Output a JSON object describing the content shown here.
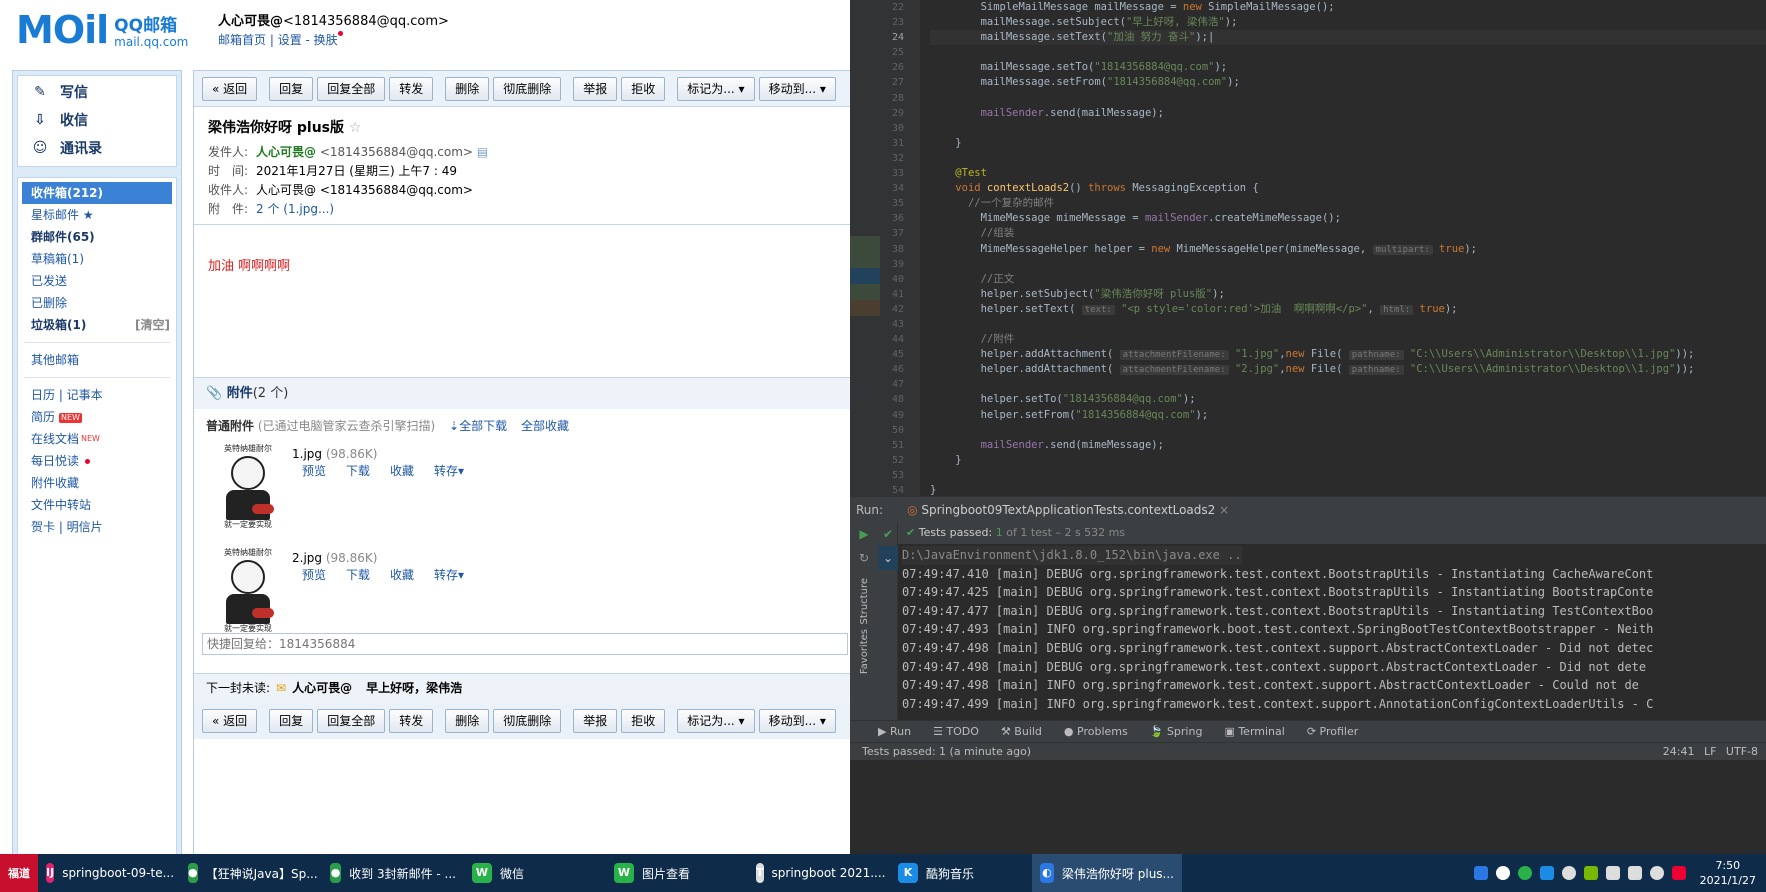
{
  "mail": {
    "logo": {
      "big": "MOil",
      "name": "QQ邮箱",
      "domain": "mail.qq.com"
    },
    "user": {
      "name": "人心可畏@",
      "email": "<1814356884@qq.com>",
      "home": "邮箱首页",
      "settings": "设置",
      "skin": "换肤"
    },
    "compose": "写信",
    "receive": "收信",
    "contacts": "通讯录",
    "folders": [
      {
        "label": "收件箱(212)",
        "selected": true
      },
      {
        "label": "星标邮件 ★"
      },
      {
        "label": "群邮件(65)",
        "bold": true
      },
      {
        "label": "草稿箱(1)"
      },
      {
        "label": "已发送"
      },
      {
        "label": "已删除"
      },
      {
        "label": "垃圾箱(1)",
        "bold": true,
        "right": "[清空]"
      },
      {
        "label": "其他邮箱"
      },
      {
        "label": "日历 | 记事本"
      },
      {
        "label": "简历",
        "badge": "NEW"
      },
      {
        "label": "在线文档",
        "sup": "NEW"
      },
      {
        "label": "每日悦读",
        "dot": true
      },
      {
        "label": "附件收藏"
      },
      {
        "label": "文件中转站"
      },
      {
        "label": "贺卡 | 明信片"
      }
    ],
    "toolbar": [
      "« 返回",
      "回复",
      "回复全部",
      "转发",
      "删除",
      "彻底删除",
      "举报",
      "拒收",
      "标记为... ▾",
      "移动到... ▾"
    ],
    "subject": "梁伟浩你好呀 plus版",
    "sender_label": "发件人:",
    "sender_name": "人心可畏@",
    "sender_email": "<1814356884@qq.com>",
    "time_label": "时　间:",
    "time": "2021年1月27日 (星期三) 上午7 : 49",
    "to_label": "收件人:",
    "to": "人心可畏@ <1814356884@qq.com>",
    "att_label": "附　件:",
    "att_summary": "2 个 (1.jpg...)",
    "body": "加油 啊啊啊啊",
    "attachments_title": "附件",
    "attachments_count": "(2 个)",
    "att_common": "普通附件",
    "att_scan": "(已通过电脑管家云查杀引擎扫描)",
    "download_all": "全部下载",
    "collect_all": "全部收藏",
    "att_files": [
      {
        "name": "1.jpg",
        "size": "(98.86K)",
        "caption": "英特纳雄耐尔",
        "caption2": "就一定要实现"
      },
      {
        "name": "2.jpg",
        "size": "(98.86K)",
        "caption": "英特纳雄耐尔",
        "caption2": "就一定要实现"
      }
    ],
    "att_actions": [
      "预览",
      "下载",
      "收藏",
      "转存▾"
    ],
    "quick_reply": "快捷回复给：1814356884",
    "next_label": "下一封未读:",
    "next_from": "人心可畏@",
    "next_subject": "早上好呀，梁伟浩"
  },
  "ide": {
    "code_lines": [
      {
        "n": "22",
        "html": "        SimpleMailMessage mailMessage = <span class='kw'>new</span> SimpleMailMessage();"
      },
      {
        "n": "23",
        "html": "        mailMessage.setSubject(<span class='str'>\"早上好呀, 梁伟浩\"</span>);"
      },
      {
        "n": "24",
        "html": "        mailMessage.setText(<span class='str'>\"加油 努力 奋斗\"</span>);|",
        "cur": true
      },
      {
        "n": "25",
        "html": ""
      },
      {
        "n": "26",
        "html": "        mailMessage.setTo(<span class='str'>\"1814356884@qq.com\"</span>);"
      },
      {
        "n": "27",
        "html": "        mailMessage.setFrom(<span class='str'>\"1814356884@qq.com\"</span>);"
      },
      {
        "n": "28",
        "html": ""
      },
      {
        "n": "29",
        "html": "        <span class='fld'>mailSender</span>.send(mailMessage);"
      },
      {
        "n": "30",
        "html": ""
      },
      {
        "n": "31",
        "html": "    }"
      },
      {
        "n": "32",
        "html": ""
      },
      {
        "n": "33",
        "html": "    <span class='an'>@Test</span>"
      },
      {
        "n": "34",
        "html": "    <span class='kw'>void</span> <span class='fn'>contextLoads2</span>() <span class='kw'>throws</span> MessagingException {"
      },
      {
        "n": "35",
        "html": "      <span class='cm'>//一个复杂的邮件</span>"
      },
      {
        "n": "36",
        "html": "        MimeMessage mimeMessage = <span class='fld'>mailSender</span>.createMimeMessage();"
      },
      {
        "n": "37",
        "html": "        <span class='cm'>//组装</span>"
      },
      {
        "n": "38",
        "html": "        MimeMessageHelper helper = <span class='kw'>new</span> MimeMessageHelper(mimeMessage, <span class='hint'>multipart:</span> <span class='kw'>true</span>);"
      },
      {
        "n": "39",
        "html": ""
      },
      {
        "n": "40",
        "html": "        <span class='cm'>//正文</span>"
      },
      {
        "n": "41",
        "html": "        helper.setSubject(<span class='str'>\"梁伟浩你好呀 plus版\"</span>);"
      },
      {
        "n": "42",
        "html": "        helper.setText( <span class='hint'>text:</span> <span class='str'>\"&lt;p style='color:red'&gt;加油  啊啊啊啊&lt;/p&gt;\"</span>, <span class='hint'>html:</span> <span class='kw'>true</span>);"
      },
      {
        "n": "43",
        "html": ""
      },
      {
        "n": "44",
        "html": "        <span class='cm'>//附件</span>"
      },
      {
        "n": "45",
        "html": "        helper.addAttachment( <span class='hint'>attachmentFilename:</span> <span class='str'>\"1.jpg\"</span>,<span class='kw'>new</span> File( <span class='hint'>pathname:</span> <span class='str'>\"C:\\\\Users\\\\Administrator\\\\Desktop\\\\1.jpg\"</span>));"
      },
      {
        "n": "46",
        "html": "        helper.addAttachment( <span class='hint'>attachmentFilename:</span> <span class='str'>\"2.jpg\"</span>,<span class='kw'>new</span> File( <span class='hint'>pathname:</span> <span class='str'>\"C:\\\\Users\\\\Administrator\\\\Desktop\\\\1.jpg\"</span>));"
      },
      {
        "n": "47",
        "html": ""
      },
      {
        "n": "48",
        "html": "        helper.setTo(<span class='str'>\"1814356884@qq.com\"</span>);"
      },
      {
        "n": "49",
        "html": "        helper.setFrom(<span class='str'>\"1814356884@qq.com\"</span>);"
      },
      {
        "n": "50",
        "html": ""
      },
      {
        "n": "51",
        "html": "        <span class='fld'>mailSender</span>.send(mimeMessage);"
      },
      {
        "n": "52",
        "html": "    }"
      },
      {
        "n": "53",
        "html": ""
      },
      {
        "n": "54",
        "html": "}"
      }
    ],
    "run_label": "Run:",
    "run_tab": "Springboot09TextApplicationTests.contextLoads2",
    "tests_passed": "Tests passed:",
    "tests_count": "1",
    "tests_detail": "of 1 test – 2 s 532 ms",
    "console": [
      "D:\\JavaEnvironment\\jdk1.8.0_152\\bin\\java.exe ...",
      "07:49:47.410 [main] DEBUG org.springframework.test.context.BootstrapUtils - Instantiating CacheAwareCont",
      "07:49:47.425 [main] DEBUG org.springframework.test.context.BootstrapUtils - Instantiating BootstrapConte",
      "07:49:47.477 [main] DEBUG org.springframework.test.context.BootstrapUtils - Instantiating TestContextBoo",
      "07:49:47.493 [main] INFO org.springframework.boot.test.context.SpringBootTestContextBootstrapper - Neith",
      "07:49:47.498 [main] DEBUG org.springframework.test.context.support.AbstractContextLoader - Did not detec",
      "07:49:47.498 [main] DEBUG org.springframework.test.context.support.AbstractContextLoader - Did not dete",
      "07:49:47.498 [main] INFO org.springframework.test.context.support.AbstractContextLoader - Could not de",
      "07:49:47.499 [main] INFO org.springframework.test.context.support.AnnotationConfigContextLoaderUtils - C"
    ],
    "side_tabs": [
      "Structure",
      "Favorites"
    ],
    "bottom_tabs": [
      "▶ Run",
      "☰ TODO",
      "⚒ Build",
      "● Problems",
      "🍃 Spring",
      "▣ Terminal",
      "⟳ Profiler"
    ],
    "status": "Tests passed: 1 (a minute ago)",
    "status_right": "24:41  LF  UTF-8"
  },
  "taskbar": {
    "apps": [
      {
        "label": "springboot-09-te...",
        "icon": "IJ",
        "color": "#e2246e"
      },
      {
        "label": "【狂神说Java】Sp...",
        "icon": "●",
        "color": "#2a9d4a"
      },
      {
        "label": "收到 3封新邮件 - ...",
        "icon": "●",
        "color": "#2a9d4a"
      },
      {
        "label": "微信",
        "icon": "W",
        "color": "#2ab24a"
      },
      {
        "label": "图片查看",
        "icon": "W",
        "color": "#2ab24a"
      },
      {
        "label": "springboot 2021....",
        "icon": "T",
        "color": "#ddd"
      },
      {
        "label": "酷狗音乐",
        "icon": "K",
        "color": "#1a8ce6"
      },
      {
        "label": "梁伟浩你好呀 plus...",
        "icon": "◐",
        "color": "#2b78e4",
        "active": true
      }
    ],
    "start_label": "福道",
    "time": "7:50",
    "date": "2021/1/27"
  }
}
